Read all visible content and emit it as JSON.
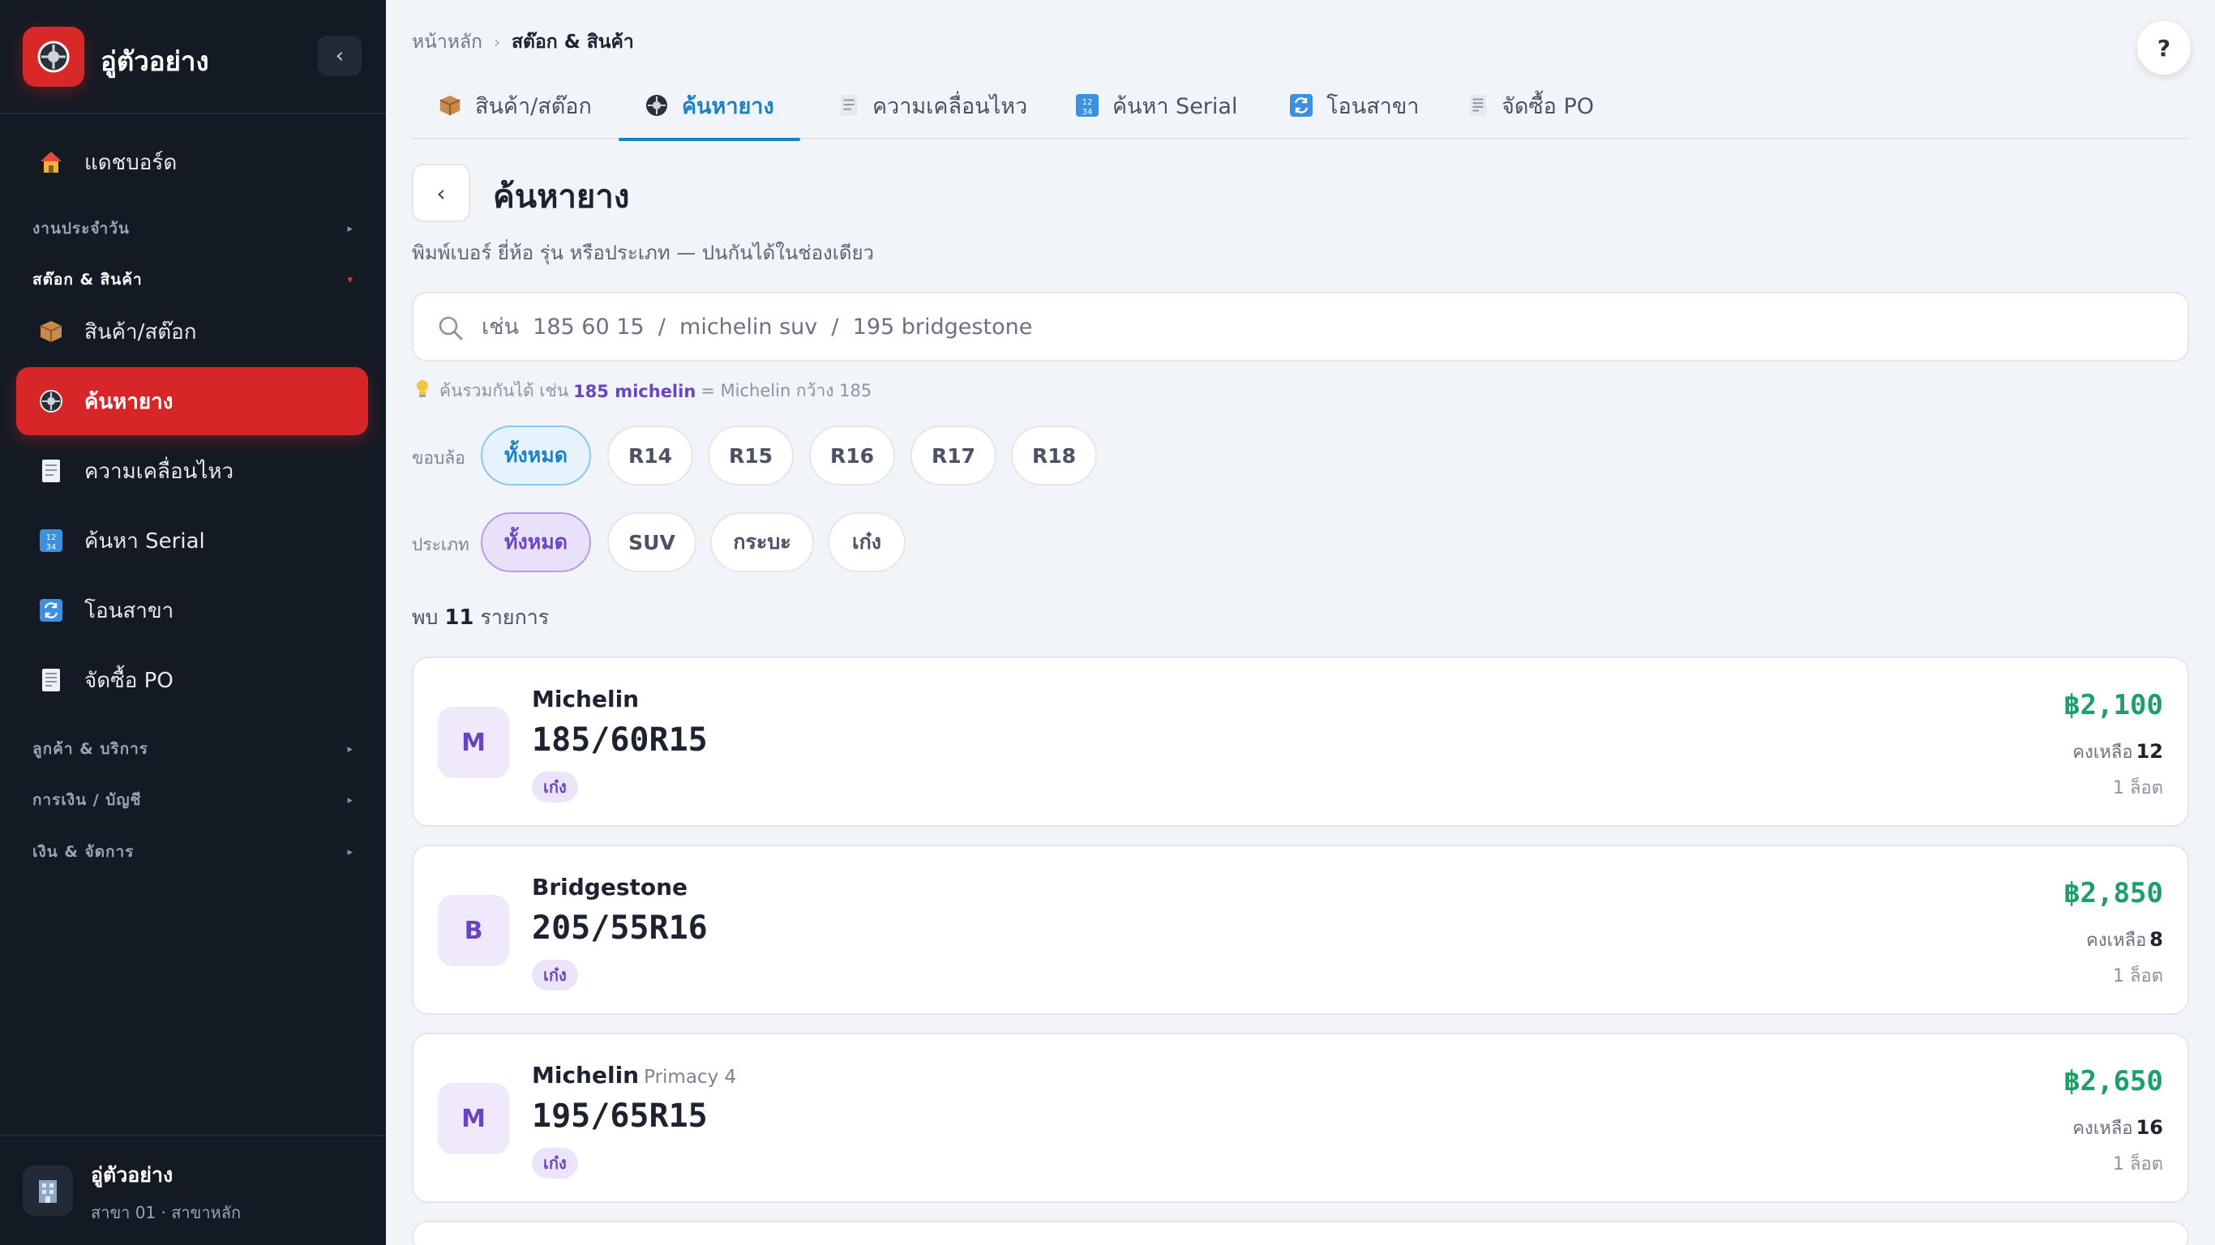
{
  "brand": {
    "title": "อู่ตัวอย่าง",
    "collapse_glyph": "‹"
  },
  "sidebar": {
    "dashboard": "แดชบอร์ด",
    "groups": [
      {
        "label": "งานประจำวัน",
        "arrow": "▸"
      },
      {
        "label": "สต๊อก & สินค้า",
        "arrow": "▾"
      },
      {
        "label": "ลูกค้า & บริการ",
        "arrow": "▸"
      },
      {
        "label": "การเงิน / บัญชี",
        "arrow": "▸"
      },
      {
        "label": "เงิน & จัดการ",
        "arrow": "▸"
      }
    ],
    "items": [
      {
        "label": "สินค้า/สต๊อก",
        "icon": "package-icon"
      },
      {
        "label": "ค้นหายาง",
        "icon": "tire-icon",
        "active": true
      },
      {
        "label": "ความเคลื่อนไหว",
        "icon": "receipt-icon"
      },
      {
        "label": "ค้นหา Serial",
        "icon": "number-grid-icon"
      },
      {
        "label": "โอนสาขา",
        "icon": "transfer-icon"
      },
      {
        "label": "จัดซื้อ PO",
        "icon": "document-icon"
      }
    ],
    "footer": {
      "name": "อู่ตัวอย่าง",
      "branch": "สาขา 01 · สาขาหลัก"
    }
  },
  "breadcrumb": {
    "home": "หน้าหลัก",
    "sep": "›",
    "current": "สต๊อก & สินค้า"
  },
  "help_label": "?",
  "tabs": [
    {
      "label": "สินค้า/สต๊อก",
      "icon": "package-icon"
    },
    {
      "label": "ค้นหายาง",
      "icon": "tire-icon",
      "active": true
    },
    {
      "label": "ความเคลื่อนไหว",
      "icon": "receipt-icon"
    },
    {
      "label": "ค้นหา Serial",
      "icon": "number-grid-icon"
    },
    {
      "label": "โอนสาขา",
      "icon": "transfer-icon"
    },
    {
      "label": "จัดซื้อ PO",
      "icon": "document-icon"
    }
  ],
  "page": {
    "back_glyph": "‹",
    "title": "ค้นหายาง",
    "subtitle": "พิมพ์เบอร์ ยี่ห้อ รุ่น หรือประเภท — ปนกันได้ในช่องเดียว"
  },
  "search": {
    "value": "",
    "placeholder": "เช่น  185 60 15  /  michelin suv  /  195 bridgestone"
  },
  "hint": {
    "prefix": "ค้นรวมกันได้ เช่น",
    "highlight": "185 michelin",
    "suffix": "= Michelin กว้าง 185"
  },
  "filters": {
    "rim": {
      "label": "ขอบล้อ",
      "options": [
        "ทั้งหมด",
        "R14",
        "R15",
        "R16",
        "R17",
        "R18"
      ],
      "selected": 0
    },
    "type": {
      "label": "ประเภท",
      "options": [
        "ทั้งหมด",
        "SUV",
        "กระบะ",
        "เก๋ง"
      ],
      "selected": 0
    }
  },
  "results": {
    "prefix": "พบ",
    "count": "11",
    "suffix": "รายการ"
  },
  "cards": [
    {
      "initial": "M",
      "brand": "Michelin",
      "model": "",
      "size": "185/60R15",
      "tag": "เก๋ง",
      "price": "฿2,100",
      "stock_label": "คงเหลือ",
      "stock": "12",
      "lots": "1 ล็อต"
    },
    {
      "initial": "B",
      "brand": "Bridgestone",
      "model": "",
      "size": "205/55R16",
      "tag": "เก๋ง",
      "price": "฿2,850",
      "stock_label": "คงเหลือ",
      "stock": "8",
      "lots": "1 ล็อต"
    },
    {
      "initial": "M",
      "brand": "Michelin",
      "model": "Primacy 4",
      "size": "195/65R15",
      "tag": "เก๋ง",
      "price": "฿2,650",
      "stock_label": "คงเหลือ",
      "stock": "16",
      "lots": "1 ล็อต"
    }
  ],
  "colors": {
    "accent_red": "#d62628",
    "accent_blue": "#1a82c4",
    "accent_purple": "#6a44c4",
    "price_green": "#1e9e6a",
    "sidebar_bg": "#141a24"
  }
}
